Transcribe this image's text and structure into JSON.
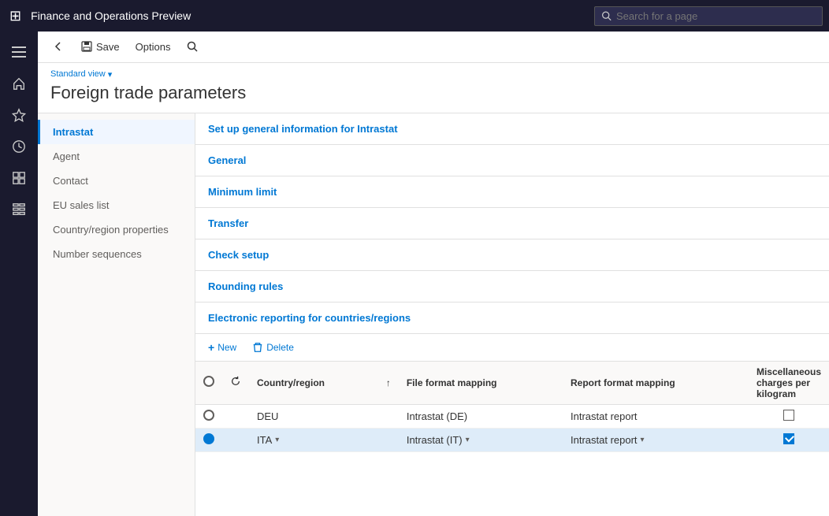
{
  "topbar": {
    "app_title": "Finance and Operations Preview",
    "search_placeholder": "Search for a page",
    "waffle_icon": "⊞"
  },
  "commandbar": {
    "back_label": "←",
    "save_label": "Save",
    "options_label": "Options",
    "search_icon": "🔍"
  },
  "page": {
    "view_label": "Standard view",
    "title": "Foreign trade parameters"
  },
  "nav": {
    "items": [
      {
        "id": "intrastat",
        "label": "Intrastat",
        "active": true
      },
      {
        "id": "agent",
        "label": "Agent",
        "active": false
      },
      {
        "id": "contact",
        "label": "Contact",
        "active": false
      },
      {
        "id": "eu-sales-list",
        "label": "EU sales list",
        "active": false
      },
      {
        "id": "country-region",
        "label": "Country/region properties",
        "active": false
      },
      {
        "id": "number-sequences",
        "label": "Number sequences",
        "active": false
      }
    ]
  },
  "content": {
    "subtitle": "Set up general information for Intrastat",
    "sections": [
      {
        "id": "general",
        "label": "General"
      },
      {
        "id": "minimum-limit",
        "label": "Minimum limit"
      },
      {
        "id": "transfer",
        "label": "Transfer"
      },
      {
        "id": "check-setup",
        "label": "Check setup"
      },
      {
        "id": "rounding-rules",
        "label": "Rounding rules"
      }
    ],
    "er_section": {
      "title": "Electronic reporting for countries/regions",
      "new_label": "New",
      "delete_label": "Delete",
      "columns": [
        {
          "id": "selector",
          "label": ""
        },
        {
          "id": "refresh",
          "label": ""
        },
        {
          "id": "country_region",
          "label": "Country/region"
        },
        {
          "id": "sort",
          "label": "↑"
        },
        {
          "id": "file_format_mapping",
          "label": "File format mapping"
        },
        {
          "id": "report_format_mapping",
          "label": "Report format mapping"
        },
        {
          "id": "misc_charges",
          "label": "Miscellaneous charges per kilogram"
        }
      ],
      "rows": [
        {
          "id": "deu",
          "selected": false,
          "country_region": "DEU",
          "file_format_mapping": "Intrastat (DE)",
          "report_format_mapping": "Intrastat report",
          "misc_charges_checked": false
        },
        {
          "id": "ita",
          "selected": true,
          "country_region": "ITA",
          "file_format_mapping": "Intrastat (IT)",
          "report_format_mapping": "Intrastat report",
          "misc_charges_checked": true
        }
      ]
    }
  },
  "sidebar_icons": [
    {
      "id": "home",
      "icon": "⌂"
    },
    {
      "id": "favorites",
      "icon": "☆"
    },
    {
      "id": "recent",
      "icon": "⏱"
    },
    {
      "id": "workspaces",
      "icon": "▦"
    },
    {
      "id": "modules",
      "icon": "☰"
    }
  ]
}
